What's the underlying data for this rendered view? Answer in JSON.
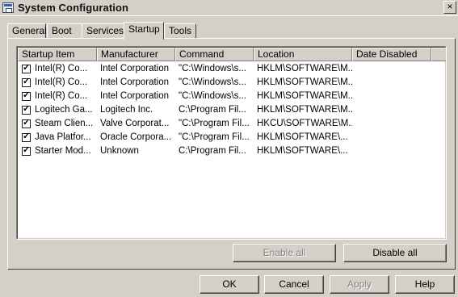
{
  "window": {
    "title": "System Configuration",
    "close_glyph": "×"
  },
  "tabs": [
    {
      "label": "General"
    },
    {
      "label": "Boot"
    },
    {
      "label": "Services"
    },
    {
      "label": "Startup",
      "active": true
    },
    {
      "label": "Tools"
    }
  ],
  "startup_list": {
    "columns": [
      {
        "label": "Startup Item"
      },
      {
        "label": "Manufacturer"
      },
      {
        "label": "Command"
      },
      {
        "label": "Location"
      },
      {
        "label": "Date Disabled"
      }
    ],
    "rows": [
      {
        "checked": true,
        "item": "Intel(R) Co...",
        "manufacturer": "Intel Corporation",
        "command": "\"C:\\Windows\\s...",
        "location": "HKLM\\SOFTWARE\\M...",
        "date_disabled": ""
      },
      {
        "checked": true,
        "item": "Intel(R) Co...",
        "manufacturer": "Intel Corporation",
        "command": "\"C:\\Windows\\s...",
        "location": "HKLM\\SOFTWARE\\M...",
        "date_disabled": ""
      },
      {
        "checked": true,
        "item": "Intel(R) Co...",
        "manufacturer": "Intel Corporation",
        "command": "\"C:\\Windows\\s...",
        "location": "HKLM\\SOFTWARE\\M...",
        "date_disabled": ""
      },
      {
        "checked": true,
        "item": "Logitech Ga...",
        "manufacturer": "Logitech Inc.",
        "command": "C:\\Program Fil...",
        "location": "HKLM\\SOFTWARE\\M...",
        "date_disabled": ""
      },
      {
        "checked": true,
        "item": "Steam Clien...",
        "manufacturer": "Valve Corporat...",
        "command": "\"C:\\Program Fil...",
        "location": "HKCU\\SOFTWARE\\M...",
        "date_disabled": ""
      },
      {
        "checked": true,
        "item": "Java Platfor...",
        "manufacturer": "Oracle Corpora...",
        "command": "\"C:\\Program Fil...",
        "location": "HKLM\\SOFTWARE\\...",
        "date_disabled": ""
      },
      {
        "checked": true,
        "item": "Starter Mod...",
        "manufacturer": "Unknown",
        "command": "C:\\Program Fil...",
        "location": "HKLM\\SOFTWARE\\...",
        "date_disabled": ""
      }
    ],
    "check_glyph": "✓"
  },
  "panel_buttons": {
    "enable_all": {
      "label": "Enable all",
      "enabled": false
    },
    "disable_all": {
      "label": "Disable all",
      "enabled": true
    }
  },
  "dialog_buttons": {
    "ok": {
      "label": "OK",
      "enabled": true
    },
    "cancel": {
      "label": "Cancel",
      "enabled": true
    },
    "apply": {
      "label": "Apply",
      "enabled": false
    },
    "help": {
      "label": "Help",
      "enabled": true
    }
  },
  "colors": {
    "face": "#d4d0c8",
    "shadow": "#808080",
    "highlight": "#ffffff",
    "disabled_text": "#808080"
  }
}
